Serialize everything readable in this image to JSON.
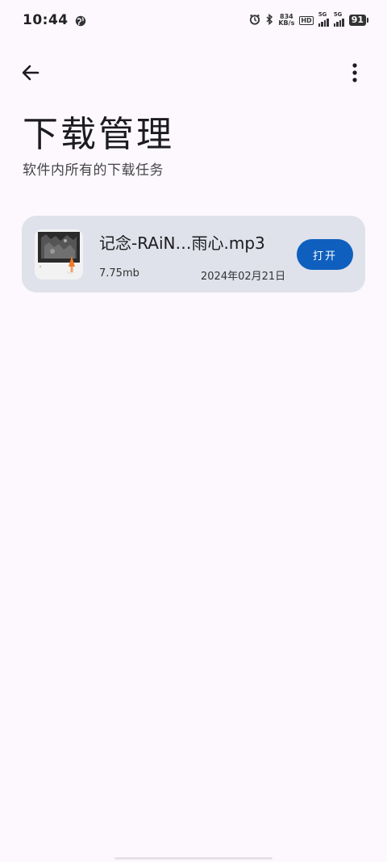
{
  "status_bar": {
    "time": "10:44",
    "net_speed_value": "834",
    "net_speed_unit": "KB/s",
    "hd_label": "HD",
    "signal1_label": "5G",
    "signal2_label": "5G",
    "battery": "91"
  },
  "header": {
    "title": "下载管理",
    "subtitle": "软件内所有的下载任务"
  },
  "downloads": [
    {
      "name": "记念-RAiN…雨心.mp3",
      "size": "7.75mb",
      "date": "2024年02月21日",
      "action_label": "打开"
    }
  ],
  "colors": {
    "background": "#fcf8fe",
    "card": "#dfe2eb",
    "accent": "#0f5fbf"
  }
}
